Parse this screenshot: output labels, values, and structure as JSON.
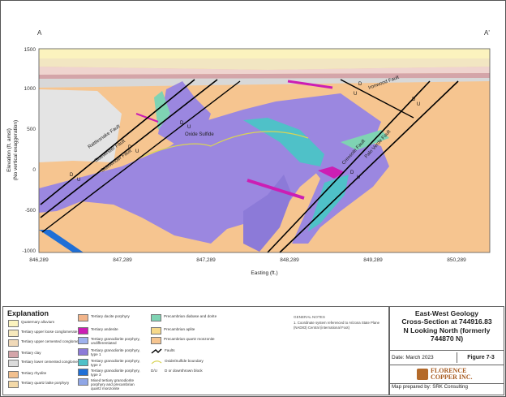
{
  "section": {
    "left_label": "A",
    "right_label": "A'"
  },
  "axes": {
    "y_title_line1": "Elevation (ft. amsl)",
    "y_title_line2": "(No vertical exaggeration)",
    "x_title": "Easting (ft.)",
    "y_ticks": [
      "1500",
      "1000",
      "500",
      "0",
      "-500",
      "-1000"
    ],
    "x_ticks": [
      "846,289",
      "847,289",
      "847,289",
      "848,289",
      "849,289",
      "850,289"
    ]
  },
  "faults": [
    {
      "name": "Sidewinder Fault"
    },
    {
      "name": "Rattlesnake Fault"
    },
    {
      "name": "Sidewinder Fault"
    },
    {
      "name": "Oxide Sulfide"
    },
    {
      "name": "Ironwood Fault"
    },
    {
      "name": "Creosote Fault"
    },
    {
      "name": "Palo Verde Fault"
    }
  ],
  "du": [
    "D",
    "U"
  ],
  "colors": {
    "basin": "#f6c590",
    "alluvium": "#fbf3be",
    "upper_conglomerate": "#f2e6c2",
    "clay": "#d4a5a9",
    "lower_conglomerate": "#dcdcdc",
    "diorite_band": "#e8e8e8",
    "granodiorite": "#9b87e0",
    "granodiorite_purple": "#8c7ad8",
    "andesite": "#cc1eb4",
    "type3": "#1f6fd6",
    "diabase": "#7fd3b3",
    "teal": "#4fc1c8"
  },
  "explanation": {
    "title": "Explanation",
    "col1": [
      {
        "label": "Quaternary alluvium",
        "color": "#fbf3be"
      },
      {
        "label": "Tertiary upper loose conglomerate",
        "color": "#f6e9bd"
      },
      {
        "label": "Tertiary upper cemented conglomerate",
        "color": "#f0d9b8"
      },
      {
        "label": "Tertiary clay",
        "color": "#d4a5a9"
      },
      {
        "label": "Tertiary lower cemented conglomerate",
        "color": "#dcdcdc"
      },
      {
        "label": "Tertiary rhyolite",
        "color": "#f2c08e"
      },
      {
        "label": "Tertiary quartz latite porphyry",
        "color": "#f3d9a8"
      }
    ],
    "col2": [
      {
        "label": "Tertiary dacite porphyry",
        "color": "#f1b48a"
      },
      {
        "label": "Tertiary andesite",
        "color": "#cc1eb4"
      },
      {
        "label": "Tertiary granodiorite porphyry, undifferentiated",
        "color": "#9fb2ee"
      },
      {
        "label": "Tertiary granodiorite porphyry, type 1",
        "color": "#8c7ad8"
      },
      {
        "label": "Tertiary granodiorite porphyry, type 2",
        "color": "#4fc1c8"
      },
      {
        "label": "Tertiary granodiorite porphyry, type 3",
        "color": "#1f6fd6"
      },
      {
        "label": "Mixed tertiary granodiorite porphyry and precambrian quartz monzonite",
        "color": "#8fa6e6"
      }
    ],
    "col3": [
      {
        "label": "Precambrian diabase and dorite",
        "color": "#7fd3b3"
      },
      {
        "label": "Precambrian aplite",
        "color": "#f6d98a"
      },
      {
        "label": "Precambrian quartz monzonite",
        "color": "#f6c590"
      },
      {
        "label": "Faults"
      },
      {
        "label": "Oxide/Sulfide boundary"
      },
      {
        "label": "D or downthrown block",
        "prefix": "D/U"
      }
    ]
  },
  "notes": {
    "title": "GENERAL NOTES",
    "items": [
      "1. Coordinate system referenced to Arizona State Plane (NAD83) Central (international Foot)"
    ]
  },
  "title_block": {
    "title_lines": [
      "East-West Geology",
      "Cross-Section at 744916.83",
      "N Looking North (formerly",
      "744870 N)"
    ],
    "date": "Date:  March 2023",
    "figure": "Figure 7-3",
    "logo_line1": "FLORENCE",
    "logo_line2": "COPPER INC.",
    "prepared_by": "Map prepared by:  SRK Consulting"
  }
}
